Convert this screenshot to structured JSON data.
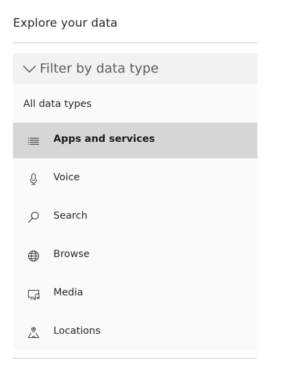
{
  "heading": "Explore your data",
  "filter": {
    "label": "Filter by data type",
    "icon": "chevron-down-icon"
  },
  "list": {
    "all_label": "All data types",
    "items": [
      {
        "label": "Apps and services",
        "icon": "list-icon",
        "selected": true
      },
      {
        "label": "Voice",
        "icon": "microphone-icon",
        "selected": false
      },
      {
        "label": "Search",
        "icon": "search-icon",
        "selected": false
      },
      {
        "label": "Browse",
        "icon": "globe-icon",
        "selected": false
      },
      {
        "label": "Media",
        "icon": "media-icon",
        "selected": false
      },
      {
        "label": "Locations",
        "icon": "location-icon",
        "selected": false
      }
    ]
  },
  "colors": {
    "selected_bg": "#d6d6d6",
    "header_bg": "#f2f2f2",
    "list_bg": "#fafafa"
  }
}
